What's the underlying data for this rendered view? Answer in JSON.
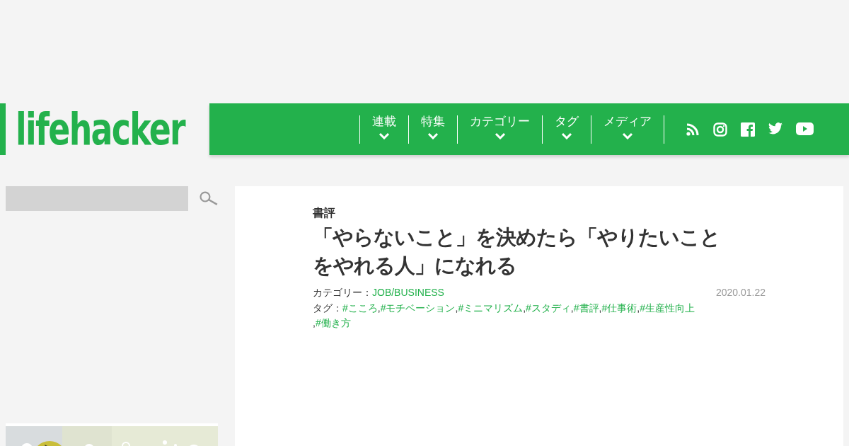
{
  "logo": "lifehacker",
  "nav": [
    {
      "label": "連載",
      "expanded": false
    },
    {
      "label": "特集",
      "expanded": false
    },
    {
      "label": "カテゴリー",
      "expanded": false
    },
    {
      "label": "タグ",
      "expanded": false
    },
    {
      "label": "メディア",
      "expanded": false
    }
  ],
  "social": [
    {
      "kind": "rss"
    },
    {
      "kind": "instagram"
    },
    {
      "kind": "facebook"
    },
    {
      "kind": "twitter"
    },
    {
      "kind": "youtube"
    }
  ],
  "article": {
    "section": "書評",
    "title": "「やらないこと」を決めたら「やりたいことをやれる人」になれる",
    "category_label": "カテゴリー：",
    "category": "JOB/BUSINESS",
    "date": "2020.01.22",
    "tags_label": "タグ：",
    "tag_separator": ",",
    "tags": [
      "#こころ",
      "#モチベーション",
      "#ミニマリズム",
      "#スタディ",
      "#書評",
      "#仕事術",
      "#生産性向上",
      "#働き方"
    ]
  }
}
